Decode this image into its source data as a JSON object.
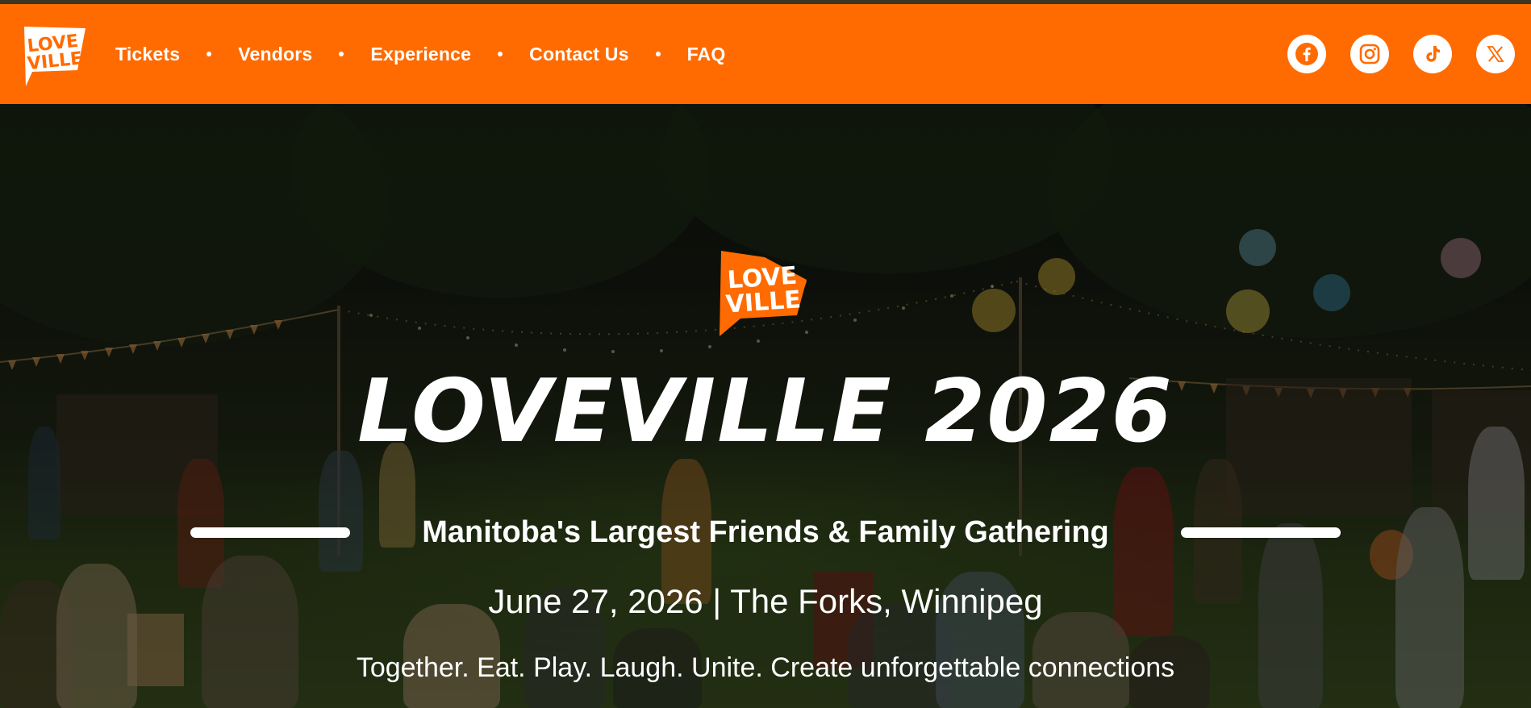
{
  "brand": {
    "logo_text_line1": "LOVE",
    "logo_text_line2": "VILLE",
    "color": "#ff6b00"
  },
  "nav": {
    "items": [
      {
        "label": "Tickets"
      },
      {
        "label": "Vendors"
      },
      {
        "label": "Experience"
      },
      {
        "label": "Contact Us"
      },
      {
        "label": "FAQ"
      }
    ]
  },
  "socials": [
    {
      "icon": "facebook-icon"
    },
    {
      "icon": "instagram-icon"
    },
    {
      "icon": "tiktok-icon"
    },
    {
      "icon": "x-icon"
    }
  ],
  "hero": {
    "title": "LOVEVILLE 2026",
    "subtitle": "Manitoba's Largest Friends & Family Gathering",
    "date_location": "June 27, 2026 | The Forks, Winnipeg",
    "tagline": "Together. Eat. Play. Laugh. Unite. Create unforgettable connections"
  }
}
